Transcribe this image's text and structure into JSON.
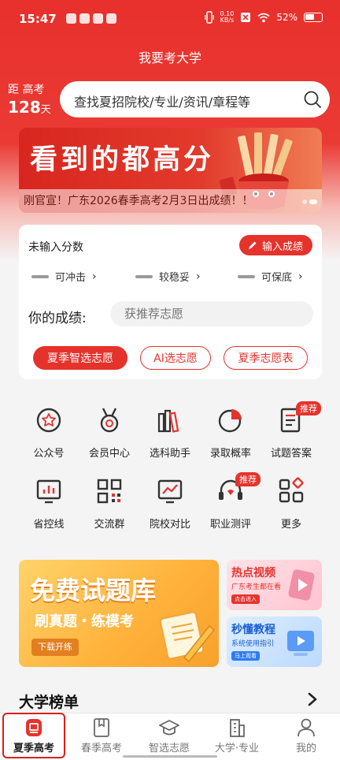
{
  "status_bar": {
    "time": "15:47",
    "net_speed_value": "0.10",
    "net_speed_unit": "KB/s",
    "battery": "52%"
  },
  "header": {
    "title": "我要考大学",
    "countdown_prefix": "距 高考",
    "countdown_days": "128",
    "countdown_unit": "天"
  },
  "search": {
    "placeholder": "查找夏招院校/专业/资讯/章程等"
  },
  "banner": {
    "headline": "看到的都高分",
    "caption": "刚官宣！广东2026春季高考2月3日出成绩！！"
  },
  "score_card": {
    "status_text": "未输入分数",
    "enter_button": "输入成绩",
    "tiers": [
      {
        "label": "可冲击"
      },
      {
        "label": "较稳妥"
      },
      {
        "label": "可保底"
      }
    ],
    "your_score_label": "你的成绩:",
    "input_placeholder": "获推荐志愿",
    "buttons": [
      {
        "label": "夏季智选志愿"
      },
      {
        "label": "AI选志愿"
      },
      {
        "label": "夏季志愿表"
      }
    ]
  },
  "quick_links": {
    "recommend_badge": "推荐",
    "items": [
      {
        "label": "公众号",
        "icon": "official-account-icon"
      },
      {
        "label": "会员中心",
        "icon": "member-medal-icon"
      },
      {
        "label": "选科助手",
        "icon": "books-icon"
      },
      {
        "label": "录取概率",
        "icon": "pie-chart-icon"
      },
      {
        "label": "试题答案",
        "icon": "document-icon"
      },
      {
        "label": "省控线",
        "icon": "bar-monitor-icon"
      },
      {
        "label": "交流群",
        "icon": "qr-code-icon"
      },
      {
        "label": "院校对比",
        "icon": "line-monitor-icon"
      },
      {
        "label": "职业测评",
        "icon": "headset-icon"
      },
      {
        "label": "更多",
        "icon": "more-grid-icon"
      }
    ]
  },
  "promos": {
    "main": {
      "title": "免费试题库",
      "subtitle": "刷真题・练模考",
      "button": "下载开练"
    },
    "hot_video": {
      "title": "热点视频",
      "subtitle": "广东考生都在看",
      "button": "点击进入"
    },
    "tutorial": {
      "title": "秒懂教程",
      "subtitle": "系统使用指引",
      "button": "马上观看"
    }
  },
  "rankings": {
    "title": "大学榜单"
  },
  "tab_bar": {
    "tabs": [
      {
        "label": "夏季高考",
        "active": true
      },
      {
        "label": "春季高考",
        "active": false
      },
      {
        "label": "智选志愿",
        "active": false
      },
      {
        "label": "大学·专业",
        "active": false
      },
      {
        "label": "我的",
        "active": false
      }
    ]
  },
  "colors": {
    "brand_red": "#e5332c",
    "promo_orange": "#ffb13a"
  }
}
